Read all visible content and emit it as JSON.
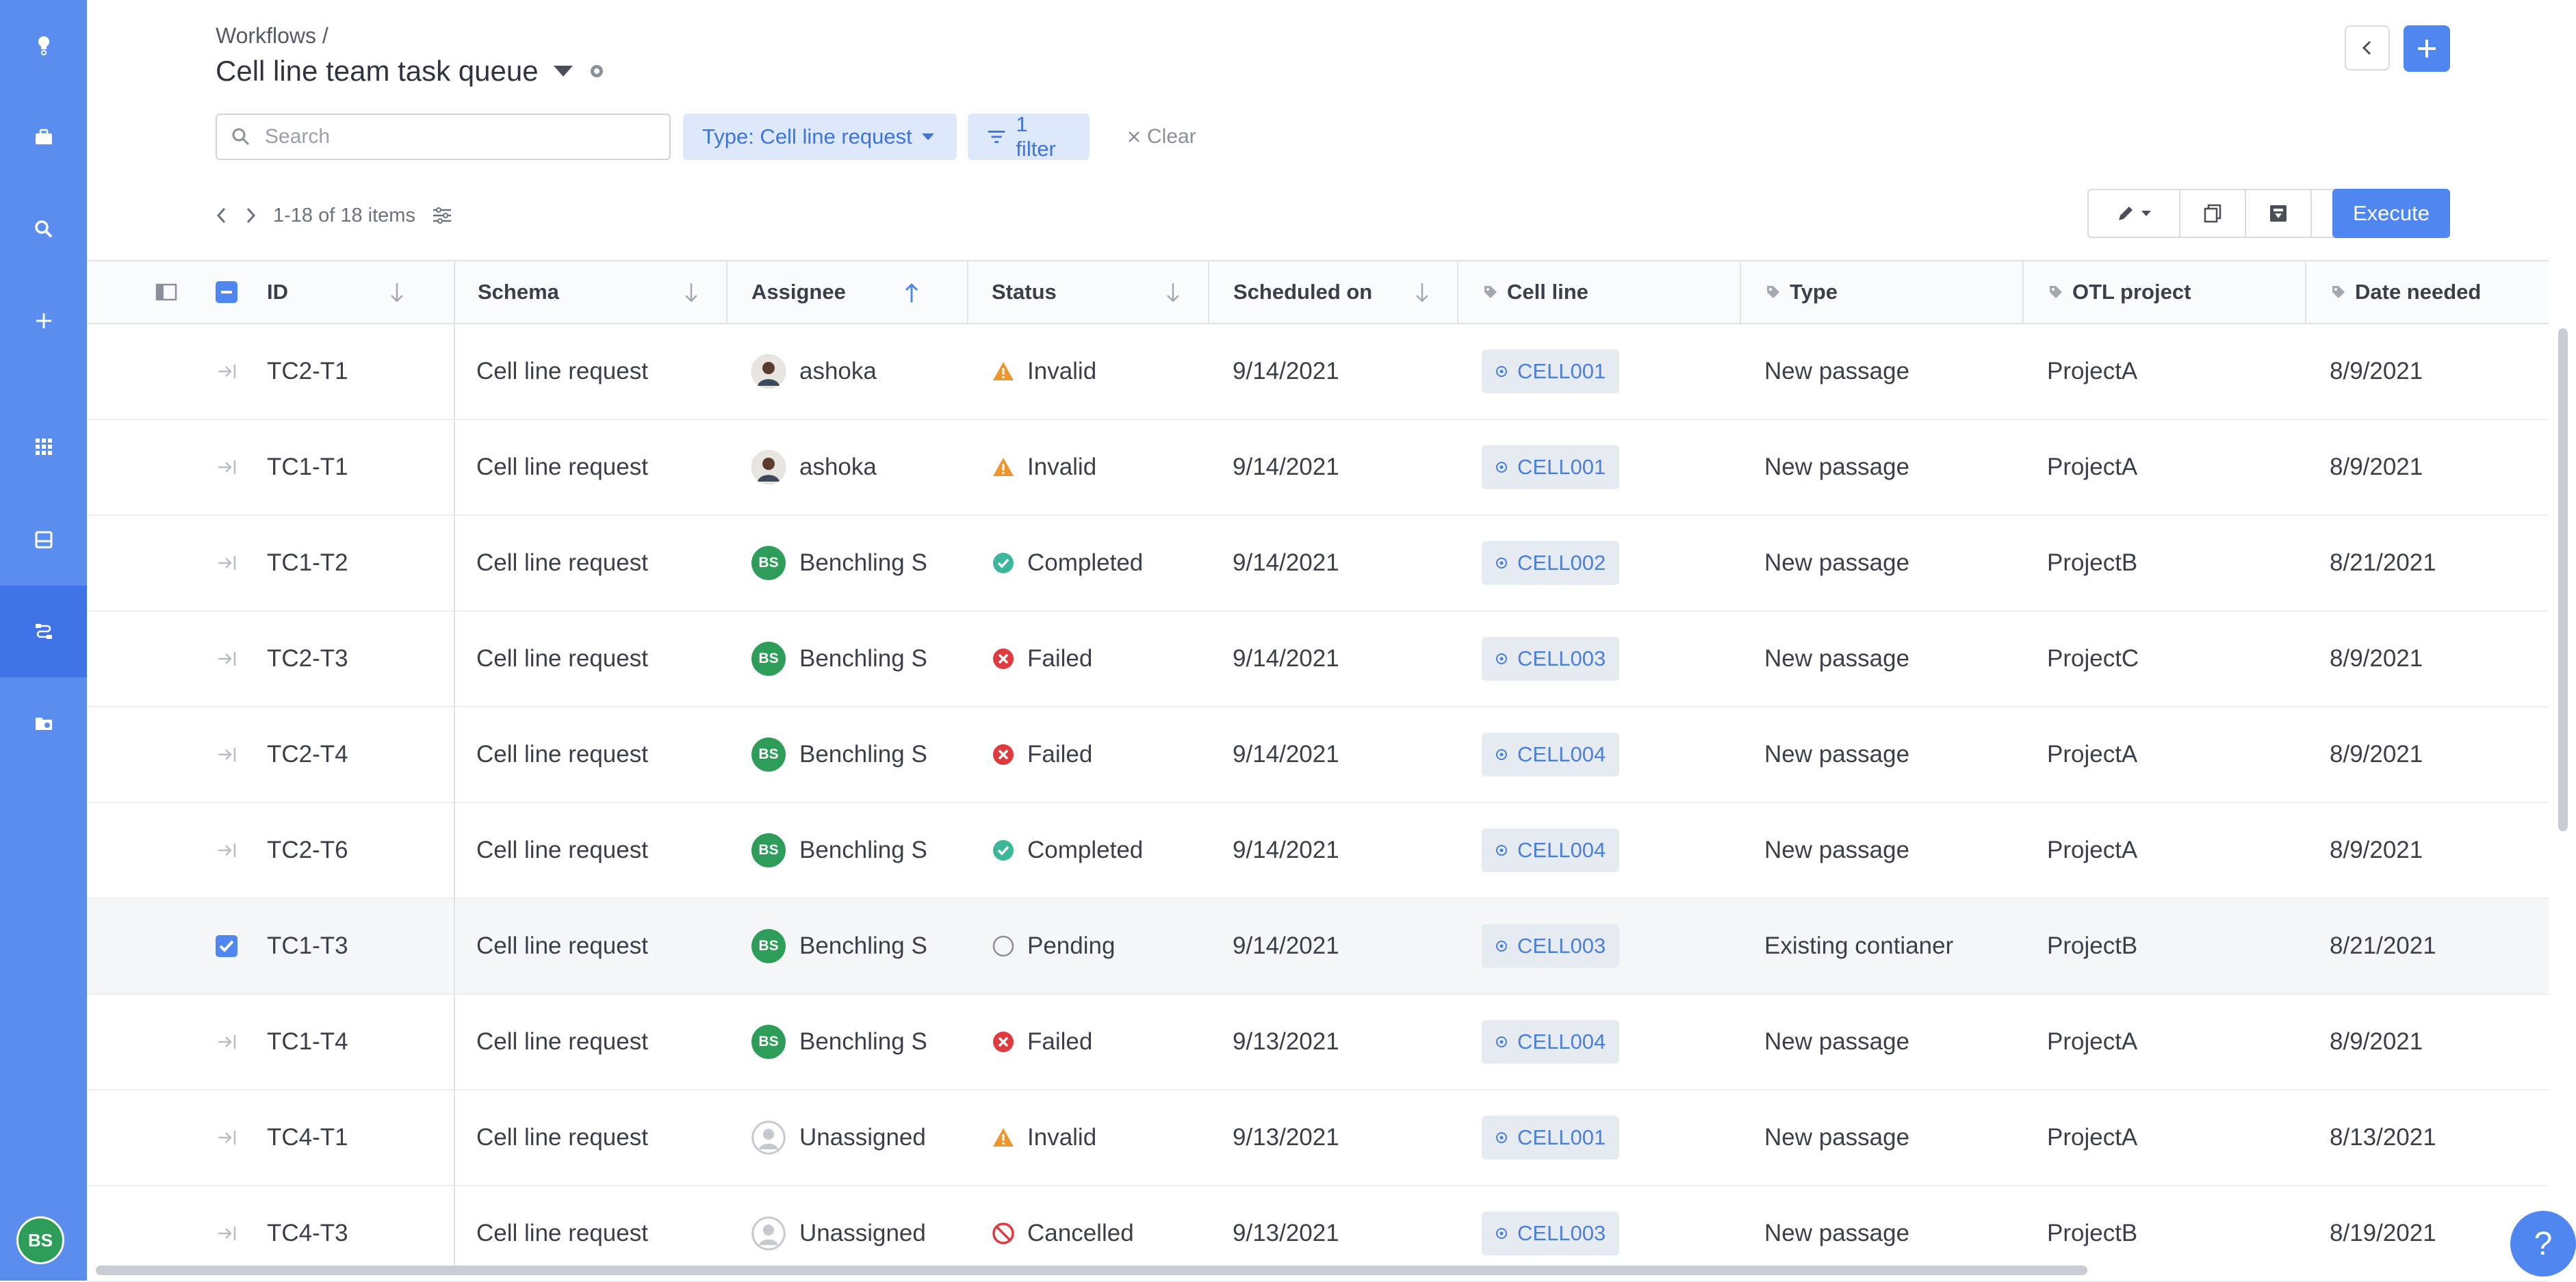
{
  "header": {
    "breadcrumb": "Workflows /",
    "title": "Cell line team task queue"
  },
  "filters": {
    "search_placeholder": "Search",
    "type_filter": "Type: Cell line request",
    "filter_count": "1 filter",
    "clear": "Clear"
  },
  "pager": {
    "range": "1-18 of 18 items"
  },
  "toolbar": {
    "execute": "Execute"
  },
  "sidebar": {
    "user_initials": "BS"
  },
  "columns": [
    "ID",
    "Schema",
    "Assignee",
    "Status",
    "Scheduled on",
    "Cell line",
    "Type",
    "OTL project",
    "Date needed"
  ],
  "rows": [
    {
      "id": "TC2-T1",
      "schema": "Cell line request",
      "assignee": "ashoka",
      "avatar": "photo",
      "status": "Invalid",
      "scheduled": "9/14/2021",
      "cell_line": "CELL001",
      "type": "New passage",
      "project": "ProjectA",
      "date_needed": "8/9/2021",
      "checked": false
    },
    {
      "id": "TC1-T1",
      "schema": "Cell line request",
      "assignee": "ashoka",
      "avatar": "photo",
      "status": "Invalid",
      "scheduled": "9/14/2021",
      "cell_line": "CELL001",
      "type": "New passage",
      "project": "ProjectA",
      "date_needed": "8/9/2021",
      "checked": false
    },
    {
      "id": "TC1-T2",
      "schema": "Cell line request",
      "assignee": "Benchling S",
      "avatar": "BS",
      "status": "Completed",
      "scheduled": "9/14/2021",
      "cell_line": "CELL002",
      "type": "New passage",
      "project": "ProjectB",
      "date_needed": "8/21/2021",
      "checked": false
    },
    {
      "id": "TC2-T3",
      "schema": "Cell line request",
      "assignee": "Benchling S",
      "avatar": "BS",
      "status": "Failed",
      "scheduled": "9/14/2021",
      "cell_line": "CELL003",
      "type": "New passage",
      "project": "ProjectC",
      "date_needed": "8/9/2021",
      "checked": false
    },
    {
      "id": "TC2-T4",
      "schema": "Cell line request",
      "assignee": "Benchling S",
      "avatar": "BS",
      "status": "Failed",
      "scheduled": "9/14/2021",
      "cell_line": "CELL004",
      "type": "New passage",
      "project": "ProjectA",
      "date_needed": "8/9/2021",
      "checked": false
    },
    {
      "id": "TC2-T6",
      "schema": "Cell line request",
      "assignee": "Benchling S",
      "avatar": "BS",
      "status": "Completed",
      "scheduled": "9/14/2021",
      "cell_line": "CELL004",
      "type": "New passage",
      "project": "ProjectA",
      "date_needed": "8/9/2021",
      "checked": false
    },
    {
      "id": "TC1-T3",
      "schema": "Cell line request",
      "assignee": "Benchling S",
      "avatar": "BS",
      "status": "Pending",
      "scheduled": "9/14/2021",
      "cell_line": "CELL003",
      "type": "Existing contianer",
      "project": "ProjectB",
      "date_needed": "8/21/2021",
      "checked": true
    },
    {
      "id": "TC1-T4",
      "schema": "Cell line request",
      "assignee": "Benchling S",
      "avatar": "BS",
      "status": "Failed",
      "scheduled": "9/13/2021",
      "cell_line": "CELL004",
      "type": "New passage",
      "project": "ProjectA",
      "date_needed": "8/9/2021",
      "checked": false
    },
    {
      "id": "TC4-T1",
      "schema": "Cell line request",
      "assignee": "Unassigned",
      "avatar": "none",
      "status": "Invalid",
      "scheduled": "9/13/2021",
      "cell_line": "CELL001",
      "type": "New passage",
      "project": "ProjectA",
      "date_needed": "8/13/2021",
      "checked": false
    },
    {
      "id": "TC4-T3",
      "schema": "Cell line request",
      "assignee": "Unassigned",
      "avatar": "none",
      "status": "Cancelled",
      "scheduled": "9/13/2021",
      "cell_line": "CELL003",
      "type": "New passage",
      "project": "ProjectB",
      "date_needed": "8/19/2021",
      "checked": false
    }
  ],
  "help": {
    "label": "?"
  },
  "colors": {
    "accent": "#4f86ef",
    "sidebar": "#5b8def",
    "success": "#3cb79b",
    "danger": "#e0393e",
    "warning": "#f0952b"
  }
}
